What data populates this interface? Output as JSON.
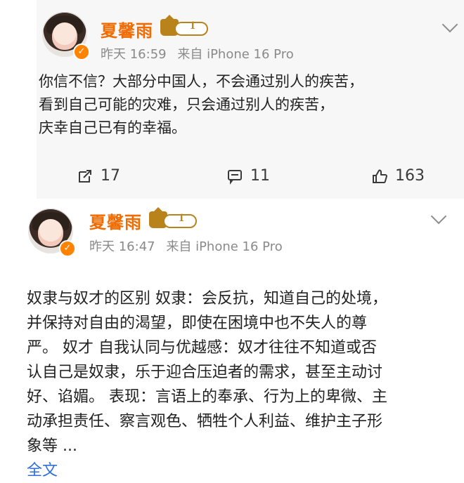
{
  "posts": [
    {
      "user_name": "夏馨雨",
      "vip_level": "1",
      "verify_glyph": "✓",
      "time": "昨天 16:59",
      "source": "来自 iPhone 16 Pro",
      "content": "你信不信？大部分中国人，不会通过别人的疾苦，\n看到自己可能的灾难，只会通过别人的疾苦，\n庆幸自己已有的幸福。",
      "actions": {
        "repost_count": "17",
        "comment_count": "11",
        "like_count": "163"
      }
    },
    {
      "user_name": "夏馨雨",
      "vip_level": "1",
      "verify_glyph": "✓",
      "time": "昨天 16:47",
      "source": "来自 iPhone 16 Pro",
      "content": "奴隶与奴才的区别 奴隶：会反抗，知道自己的处境，\n并保持对自由的渴望，即使在困境中也不失人的尊\n严。 奴才 自我认同与优越感：奴才往往不知道或否\n认自己是奴隶，乐于迎合压迫者的需求，甚至主动讨\n好、谄媚。 表现：言语上的奉承、行为上的卑微、主\n动承担责任、察言观色、牺牲个人利益、维护主子形\n象等 ...",
      "full_text_label": "全文"
    }
  ],
  "icons": {
    "repost": "repost-icon",
    "comment": "comment-icon",
    "like": "thumbs-up-icon",
    "more": "chevron-down-icon"
  },
  "colors": {
    "username": "#f06b00",
    "vip_gold": "#b9831c",
    "meta_gray": "#8a8a8a",
    "link_blue": "#2f6fdc"
  }
}
